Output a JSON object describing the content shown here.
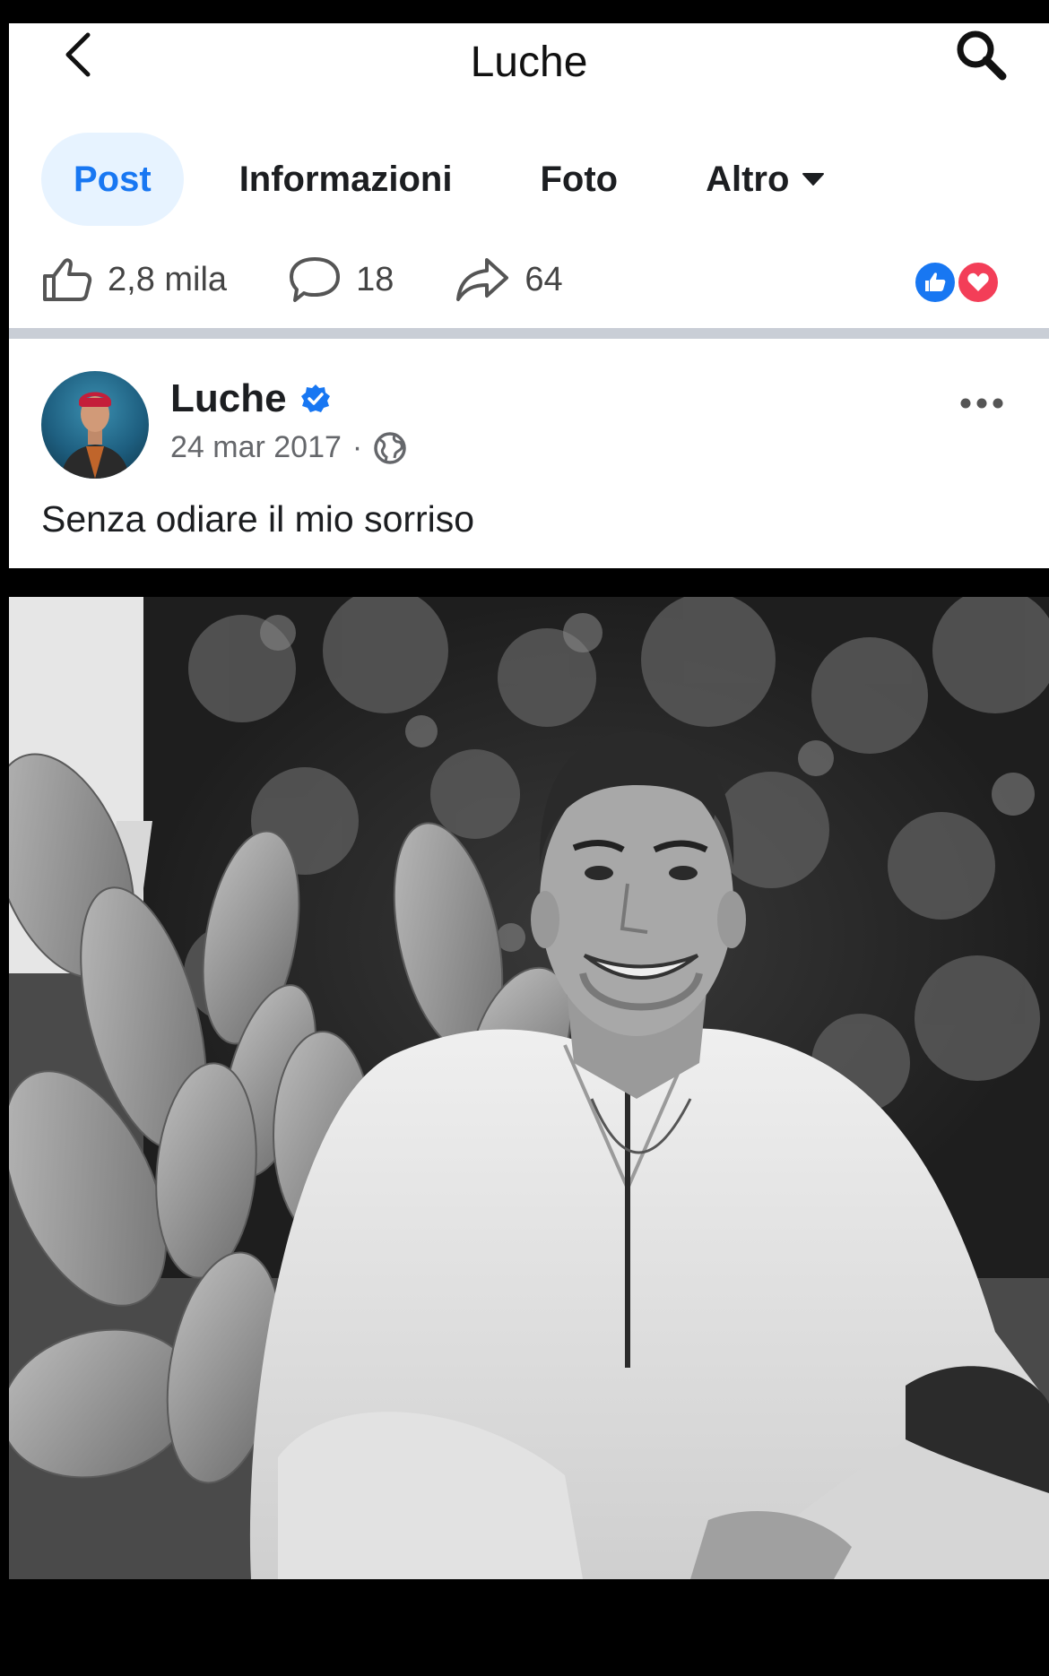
{
  "header": {
    "title": "Luche",
    "back_icon": "chevron-left-icon",
    "search_icon": "search-icon"
  },
  "tabs": [
    {
      "label": "Post",
      "active": true
    },
    {
      "label": "Informazioni",
      "active": false
    },
    {
      "label": "Foto",
      "active": false
    },
    {
      "label": "Altro",
      "active": false
    }
  ],
  "stats": {
    "likes": "2,8 mila",
    "comments": "18",
    "shares": "64"
  },
  "post": {
    "author": "Luche",
    "date": "24 mar 2017",
    "separator": "·",
    "text": "Senza odiare il mio sorriso"
  },
  "colors": {
    "accent": "#1877f2",
    "active_tab_bg": "#e7f3ff",
    "love": "#f33e58",
    "divider": "#c9ced6"
  }
}
